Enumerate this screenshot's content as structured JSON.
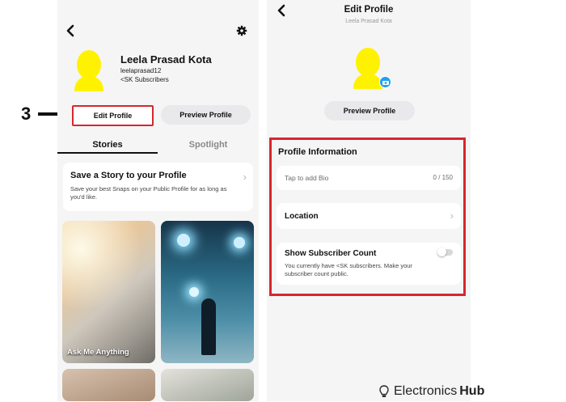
{
  "annotation": {
    "step": "3"
  },
  "left": {
    "profile": {
      "name": "Leela Prasad Kota",
      "username": "leelaprasad12",
      "subscribers": "<SK Subscribers"
    },
    "buttons": {
      "edit": "Edit Profile",
      "preview": "Preview Profile"
    },
    "tabs": [
      "Stories",
      "Spotlight"
    ],
    "save_story": {
      "title": "Save a Story to your Profile",
      "desc": "Save your best Snaps on your Public Profile for as long as you'd like."
    },
    "tile_label": "Ask Me Anything"
  },
  "right": {
    "header": {
      "title": "Edit Profile",
      "subtitle": "Leela Prasad Kota"
    },
    "preview_button": "Preview Profile",
    "section_title": "Profile Information",
    "bio": {
      "placeholder": "Tap to add Bio",
      "count": "0 / 150"
    },
    "location": "Location",
    "subscriber": {
      "title": "Show Subscriber Count",
      "desc": "You currently have <SK subscribers. Make your subscriber count public.",
      "enabled": false
    }
  },
  "watermark": {
    "part1": "Electronics",
    "part2": "Hub"
  },
  "colors": {
    "highlight": "#d7262d",
    "ghost": "#fff200",
    "ghost_outline": "#e6d800",
    "tab_underline": "#111111",
    "camera_badge": "#1da1f2"
  }
}
